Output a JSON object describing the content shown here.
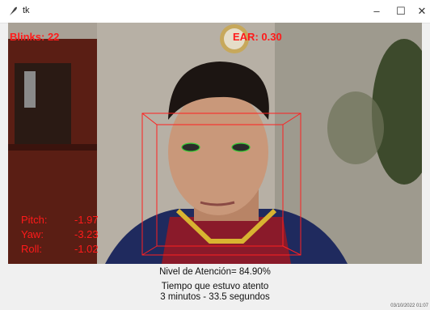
{
  "window": {
    "title": "tk",
    "minimize": "–",
    "maximize": "☐",
    "close": "✕"
  },
  "overlay": {
    "blinks": "Blinks: 22",
    "ear": "EAR: 0.30",
    "pose": [
      {
        "label": "Pitch:",
        "value": "-1.97"
      },
      {
        "label": "Yaw:",
        "value": "-3.23"
      },
      {
        "label": "Roll:",
        "value": "-1.02"
      }
    ],
    "color": "#ff1a1a"
  },
  "panel": {
    "attention": "Nivel de Atención= 84.90%",
    "time_label": "Tiempo que estuvo atento",
    "time_value": "3 minutos - 33.5 segundos",
    "datetime": "03/10/2022 01:07"
  }
}
